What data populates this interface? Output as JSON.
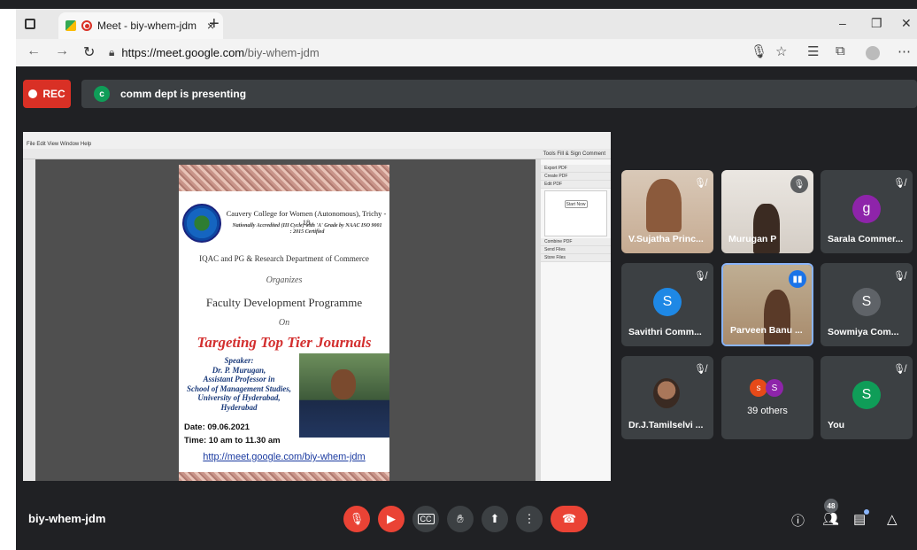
{
  "browser": {
    "tab_title": "Meet - biy-whem-jdm",
    "tab_close": "×",
    "new_tab": "+",
    "url_host": "https://meet.google.com",
    "url_path": "/biy-whem-jdm",
    "win_min": "–",
    "win_max": "❐",
    "win_close": "✕"
  },
  "meet": {
    "rec_label": "REC",
    "presenter_initial": "c",
    "presenting_text": "comm dept is presenting",
    "meeting_code": "biy-whem-jdm",
    "participant_count": "48"
  },
  "poster": {
    "college": "Cauvery College for Women (Autonomous), Trichy - 18",
    "accreditation": "Nationally Accredited (III Cycle) with 'A' Grade by NAAC ISO 9001 : 2015 Certified",
    "department": "IQAC and PG & Research Department of Commerce",
    "organizes": "Organizes",
    "programme": "Faculty Development Programme",
    "on": "On",
    "topic": "Targeting Top Tier Journals",
    "speaker_heading": "Speaker:",
    "speaker_name": "Dr. P. Murugan,",
    "speaker_role": "Assistant Professor in",
    "speaker_school": "School of Management Studies,",
    "speaker_univ": "University of Hyderabad,",
    "speaker_city": "Hyderabad",
    "date": "Date: 09.06.2021",
    "time": "Time: 10 am to 11.30 am",
    "link": "http://meet.google.com/biy-whem-jdm"
  },
  "reader": {
    "menu": "File  Edit  View  Window  Help",
    "tools": "Tools   Fill & Sign   Comment",
    "panel_items": [
      "Export PDF",
      "Create PDF",
      "Edit PDF",
      "Combine PDF",
      "Send Files",
      "Store Files"
    ],
    "start_now": "Start Now"
  },
  "participants": [
    {
      "name": "V.Sujatha Princ...",
      "type": "video"
    },
    {
      "name": "Murugan P",
      "type": "video"
    },
    {
      "name": "Sarala Commer...",
      "type": "avatar",
      "initial": "g",
      "color": "#8e24aa"
    },
    {
      "name": "Savithri Comm...",
      "type": "avatar",
      "initial": "S",
      "color": "#1e88e5"
    },
    {
      "name": "Parveen Banu ...",
      "type": "video"
    },
    {
      "name": "Sowmiya Com...",
      "type": "avatar",
      "initial": "S",
      "color": "#5f6368"
    },
    {
      "name": "Dr.J.Tamilselvi ...",
      "type": "mini"
    },
    {
      "name": "39 others",
      "type": "others",
      "a1": "s",
      "a2": "S"
    },
    {
      "name": "You",
      "type": "avatar",
      "initial": "S",
      "color": "#0f9d58"
    }
  ]
}
